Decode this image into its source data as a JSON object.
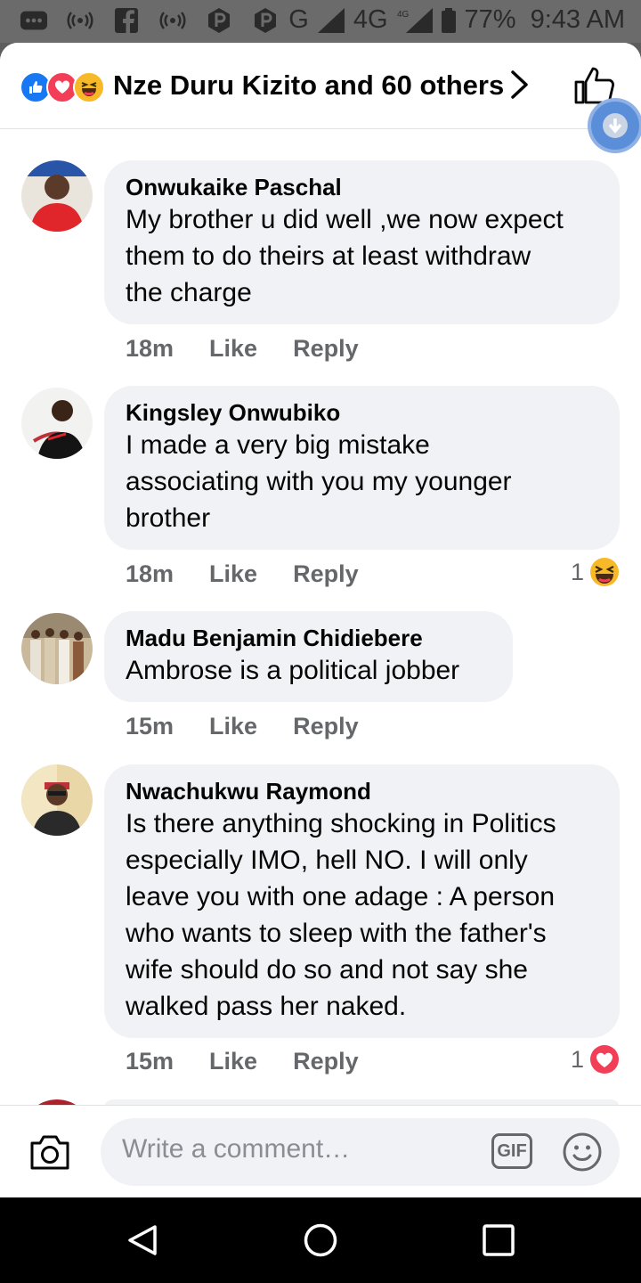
{
  "status_bar": {
    "network": "G",
    "network2": "4G",
    "battery": "77%",
    "time": "9:43 AM"
  },
  "header": {
    "title": "Nze Duru Kizito and 60 others",
    "reactions": [
      "like-icon",
      "love-icon",
      "haha-icon"
    ]
  },
  "comments": [
    {
      "author": "Onwukaike Paschal",
      "lines": [
        "My brother u did well ,we now expect",
        "them to do theirs at least withdraw",
        "the charge"
      ],
      "time": "18m",
      "like": "Like",
      "reply": "Reply"
    },
    {
      "author": "Kingsley Onwubiko",
      "lines": [
        "I made a very big mistake",
        "associating with you my younger",
        "brother"
      ],
      "time": "18m",
      "like": "Like",
      "reply": "Reply",
      "reaction_count": "1",
      "reaction": "haha-icon"
    },
    {
      "author": "Madu Benjamin Chidiebere",
      "lines": [
        "Ambrose is a political jobber"
      ],
      "time": "15m",
      "like": "Like",
      "reply": "Reply"
    },
    {
      "author": "Nwachukwu Raymond",
      "lines": [
        "Is there anything shocking in Politics",
        "especially IMO, hell NO. I will only",
        "leave you with one adage : A person",
        "who wants to sleep with the father's",
        "wife should do so and not say she",
        "walked pass her naked."
      ],
      "time": "15m",
      "like": "Like",
      "reply": "Reply",
      "reaction_count": "1",
      "reaction": "love-icon"
    }
  ],
  "composer": {
    "placeholder": "Write a comment…",
    "gif_label": "GIF"
  },
  "colors": {
    "like_blue": "#1877f2",
    "love_red": "#f33e58",
    "haha_yellow": "#f7b928",
    "bubble_bg": "#f0f2f5",
    "meta_gray": "#65676b"
  }
}
